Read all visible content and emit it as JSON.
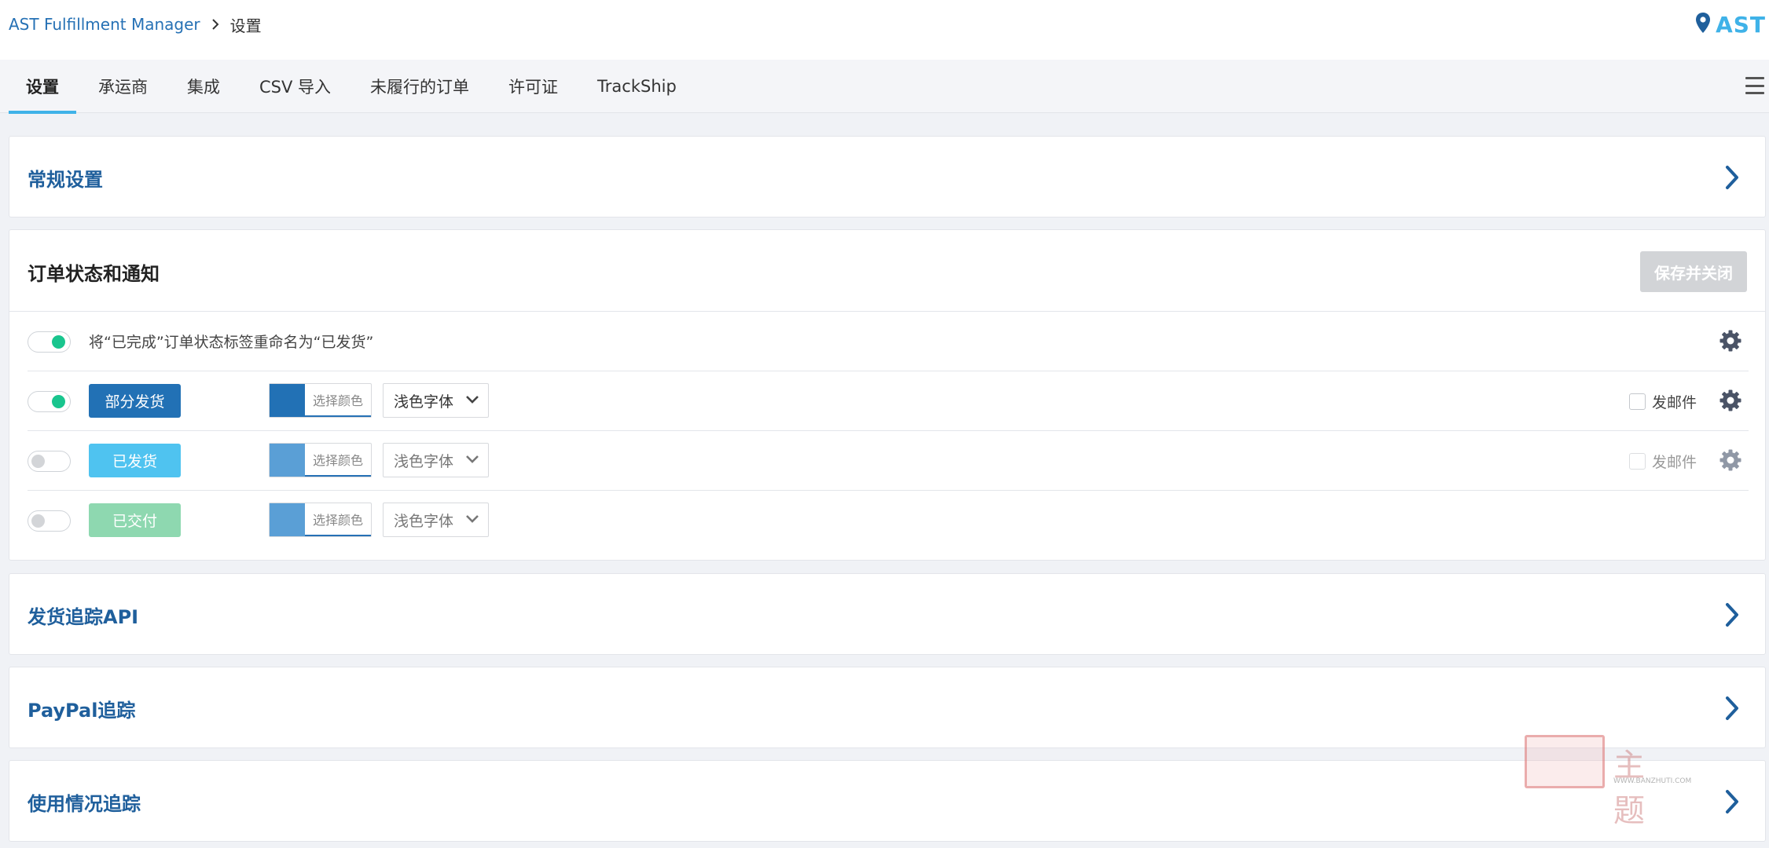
{
  "header": {
    "breadcrumb_root": "AST Fulfillment Manager",
    "breadcrumb_current": "设置",
    "brand": "AST"
  },
  "tabs": [
    {
      "label": "设置",
      "active": true
    },
    {
      "label": "承运商"
    },
    {
      "label": "集成"
    },
    {
      "label": "CSV 导入"
    },
    {
      "label": "未履行的订单"
    },
    {
      "label": "许可证"
    },
    {
      "label": "TrackShip"
    }
  ],
  "sections": {
    "general": "常规设置",
    "order_status": "订单状态和通知",
    "tracking_api": "发货追踪API",
    "paypal": "PayPal追踪",
    "usage": "使用情况追踪"
  },
  "order_status": {
    "save_label": "保存并关闭",
    "rename_label": "将“已完成”订单状态标签重命名为“已发货”",
    "rows": [
      {
        "badge": "部分发货",
        "badge_color": "#2271b5",
        "swatch_color": "#2271b5",
        "picker_label": "选择颜色",
        "font": "浅色字体",
        "email_label": "发邮件",
        "enabled": true
      },
      {
        "badge": "已发货",
        "badge_color": "#4fc3f0",
        "swatch_color": "#5a9fd6",
        "picker_label": "选择颜色",
        "font": "浅色字体",
        "email_label": "发邮件",
        "enabled": false
      },
      {
        "badge": "已交付",
        "badge_color": "#8ed8b0",
        "swatch_color": "#5a9fd6",
        "picker_label": "选择颜色",
        "font": "浅色字体",
        "enabled": false
      }
    ]
  },
  "watermark": {
    "text": "主题",
    "url": "WWW.BANZHUTI.COM"
  }
}
